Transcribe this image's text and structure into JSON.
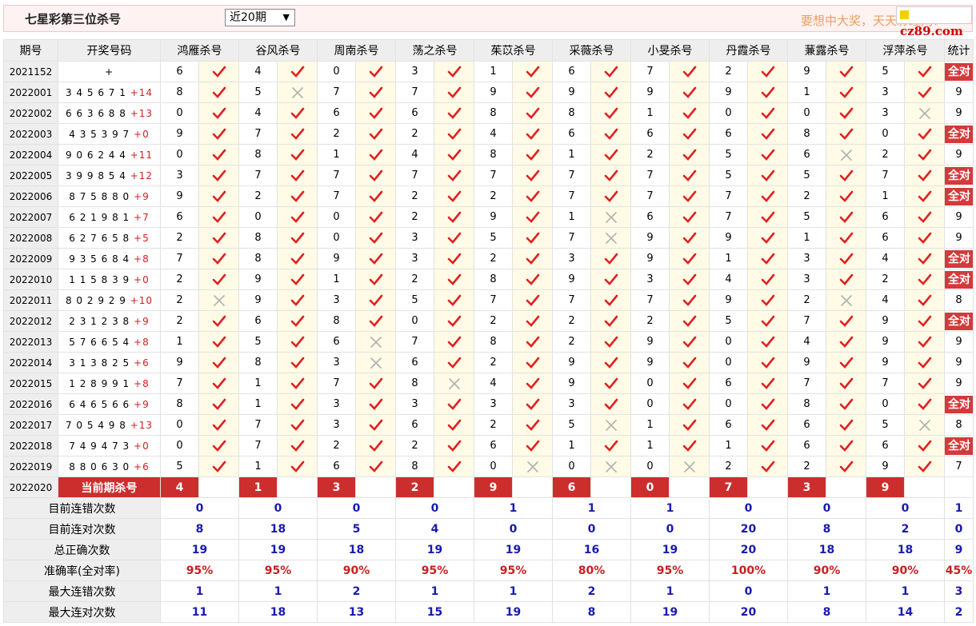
{
  "header": {
    "title": "七星彩第三位杀号",
    "period_select": "近20期",
    "slogan": "要想中大奖，天天彩经网！",
    "logo": "cz89.com"
  },
  "columns": {
    "issue": "期号",
    "draw": "开奖号码",
    "experts": [
      "鸿雁杀号",
      "谷风杀号",
      "周南杀号",
      "荡之杀号",
      "茱苡杀号",
      "采薇杀号",
      "小旻杀号",
      "丹霞杀号",
      "蒹露杀号",
      "浮萍杀号"
    ],
    "stat": "统计"
  },
  "rows": [
    {
      "issue": "2021152",
      "draw": "",
      "extra": "",
      "preds": [
        6,
        4,
        0,
        3,
        1,
        6,
        7,
        2,
        9,
        5
      ],
      "res": [
        1,
        1,
        1,
        1,
        1,
        1,
        1,
        1,
        1,
        1
      ],
      "stat": "全对"
    },
    {
      "issue": "2022001",
      "draw": "3 4 5 6 7 1",
      "extra": "14",
      "preds": [
        8,
        5,
        7,
        7,
        9,
        9,
        9,
        9,
        1,
        3
      ],
      "res": [
        1,
        0,
        1,
        1,
        1,
        1,
        1,
        1,
        1,
        1
      ],
      "stat": "9"
    },
    {
      "issue": "2022002",
      "draw": "6 6 3 6 8 8",
      "extra": "13",
      "preds": [
        0,
        4,
        6,
        6,
        8,
        8,
        1,
        0,
        0,
        3
      ],
      "res": [
        1,
        1,
        1,
        1,
        1,
        1,
        1,
        1,
        1,
        0
      ],
      "stat": "9"
    },
    {
      "issue": "2022003",
      "draw": "4 3 5 3 9 7",
      "extra": "0",
      "preds": [
        9,
        7,
        2,
        2,
        4,
        6,
        6,
        6,
        8,
        0
      ],
      "res": [
        1,
        1,
        1,
        1,
        1,
        1,
        1,
        1,
        1,
        1
      ],
      "stat": "全对"
    },
    {
      "issue": "2022004",
      "draw": "9 0 6 2 4 4",
      "extra": "11",
      "preds": [
        0,
        8,
        1,
        4,
        8,
        1,
        2,
        5,
        6,
        2
      ],
      "res": [
        1,
        1,
        1,
        1,
        1,
        1,
        1,
        1,
        0,
        1
      ],
      "stat": "9"
    },
    {
      "issue": "2022005",
      "draw": "3 9 9 8 5 4",
      "extra": "12",
      "preds": [
        3,
        7,
        7,
        7,
        7,
        7,
        7,
        5,
        5,
        7
      ],
      "res": [
        1,
        1,
        1,
        1,
        1,
        1,
        1,
        1,
        1,
        1
      ],
      "stat": "全对"
    },
    {
      "issue": "2022006",
      "draw": "8 7 5 8 8 0",
      "extra": "9",
      "preds": [
        9,
        2,
        7,
        2,
        2,
        7,
        7,
        7,
        2,
        1
      ],
      "res": [
        1,
        1,
        1,
        1,
        1,
        1,
        1,
        1,
        1,
        1
      ],
      "stat": "全对"
    },
    {
      "issue": "2022007",
      "draw": "6 2 1 9 8 1",
      "extra": "7",
      "preds": [
        6,
        0,
        0,
        2,
        9,
        1,
        6,
        7,
        5,
        6
      ],
      "res": [
        1,
        1,
        1,
        1,
        1,
        0,
        1,
        1,
        1,
        1
      ],
      "stat": "9"
    },
    {
      "issue": "2022008",
      "draw": "6 2 7 6 5 8",
      "extra": "5",
      "preds": [
        2,
        8,
        0,
        3,
        5,
        7,
        9,
        9,
        1,
        6
      ],
      "res": [
        1,
        1,
        1,
        1,
        1,
        0,
        1,
        1,
        1,
        1
      ],
      "stat": "9"
    },
    {
      "issue": "2022009",
      "draw": "9 3 5 6 8 4",
      "extra": "8",
      "preds": [
        7,
        8,
        9,
        3,
        2,
        3,
        9,
        1,
        3,
        4
      ],
      "res": [
        1,
        1,
        1,
        1,
        1,
        1,
        1,
        1,
        1,
        1
      ],
      "stat": "全对"
    },
    {
      "issue": "2022010",
      "draw": "1 1 5 8 3 9",
      "extra": "0",
      "preds": [
        2,
        9,
        1,
        2,
        8,
        9,
        3,
        4,
        3,
        2
      ],
      "res": [
        1,
        1,
        1,
        1,
        1,
        1,
        1,
        1,
        1,
        1
      ],
      "stat": "全对"
    },
    {
      "issue": "2022011",
      "draw": "8 0 2 9 2 9",
      "extra": "10",
      "preds": [
        2,
        9,
        3,
        5,
        7,
        7,
        7,
        9,
        2,
        4
      ],
      "res": [
        0,
        1,
        1,
        1,
        1,
        1,
        1,
        1,
        0,
        1
      ],
      "stat": "8"
    },
    {
      "issue": "2022012",
      "draw": "2 3 1 2 3 8",
      "extra": "9",
      "preds": [
        2,
        6,
        8,
        0,
        2,
        2,
        2,
        5,
        7,
        9
      ],
      "res": [
        1,
        1,
        1,
        1,
        1,
        1,
        1,
        1,
        1,
        1
      ],
      "stat": "全对"
    },
    {
      "issue": "2022013",
      "draw": "5 7 6 6 5 4",
      "extra": "8",
      "preds": [
        1,
        5,
        6,
        7,
        8,
        2,
        9,
        0,
        4,
        9
      ],
      "res": [
        1,
        1,
        0,
        1,
        1,
        1,
        1,
        1,
        1,
        1
      ],
      "stat": "9"
    },
    {
      "issue": "2022014",
      "draw": "3 1 3 8 2 5",
      "extra": "6",
      "preds": [
        9,
        8,
        3,
        6,
        2,
        9,
        9,
        0,
        9,
        9
      ],
      "res": [
        1,
        1,
        0,
        1,
        1,
        1,
        1,
        1,
        1,
        1
      ],
      "stat": "9"
    },
    {
      "issue": "2022015",
      "draw": "1 2 8 9 9 1",
      "extra": "8",
      "preds": [
        7,
        1,
        7,
        8,
        4,
        9,
        0,
        6,
        7,
        7
      ],
      "res": [
        1,
        1,
        1,
        0,
        1,
        1,
        1,
        1,
        1,
        1
      ],
      "stat": "9"
    },
    {
      "issue": "2022016",
      "draw": "6 4 6 5 6 6",
      "extra": "9",
      "preds": [
        8,
        1,
        3,
        3,
        3,
        3,
        0,
        0,
        8,
        0
      ],
      "res": [
        1,
        1,
        1,
        1,
        1,
        1,
        1,
        1,
        1,
        1
      ],
      "stat": "全对"
    },
    {
      "issue": "2022017",
      "draw": "7 0 5 4 9 8",
      "extra": "13",
      "preds": [
        0,
        7,
        3,
        6,
        2,
        5,
        1,
        6,
        6,
        5
      ],
      "res": [
        1,
        1,
        1,
        1,
        1,
        0,
        1,
        1,
        1,
        0
      ],
      "stat": "8"
    },
    {
      "issue": "2022018",
      "draw": "7 4 9 4 7 3",
      "extra": "0",
      "preds": [
        0,
        7,
        2,
        2,
        6,
        1,
        1,
        1,
        6,
        6
      ],
      "res": [
        1,
        1,
        1,
        1,
        1,
        1,
        1,
        1,
        1,
        1
      ],
      "stat": "全对"
    },
    {
      "issue": "2022019",
      "draw": "8 8 0 6 3 0",
      "extra": "6",
      "preds": [
        5,
        1,
        6,
        8,
        0,
        0,
        0,
        2,
        2,
        9
      ],
      "res": [
        1,
        1,
        1,
        1,
        0,
        0,
        0,
        1,
        1,
        1
      ],
      "stat": "7"
    }
  ],
  "current": {
    "issue": "2022020",
    "label": "当前期杀号",
    "preds": [
      4,
      1,
      3,
      2,
      9,
      6,
      0,
      7,
      3,
      9
    ]
  },
  "summary": [
    {
      "label": "目前连错次数",
      "values": [
        "0",
        "0",
        "0",
        "0",
        "1",
        "1",
        "1",
        "0",
        "0",
        "0",
        "1"
      ],
      "color": "blue"
    },
    {
      "label": "目前连对次数",
      "values": [
        "8",
        "18",
        "5",
        "4",
        "0",
        "0",
        "0",
        "20",
        "8",
        "2",
        "0"
      ],
      "color": "blue"
    },
    {
      "label": "总正确次数",
      "values": [
        "19",
        "19",
        "18",
        "19",
        "19",
        "16",
        "19",
        "20",
        "18",
        "18",
        "9"
      ],
      "color": "blue"
    },
    {
      "label": "准确率(全对率)",
      "values": [
        "95%",
        "95%",
        "90%",
        "95%",
        "95%",
        "80%",
        "95%",
        "100%",
        "90%",
        "90%",
        "45%"
      ],
      "color": "red"
    },
    {
      "label": "最大连错次数",
      "values": [
        "1",
        "1",
        "2",
        "1",
        "1",
        "2",
        "1",
        "0",
        "1",
        "1",
        "3"
      ],
      "color": "blue"
    },
    {
      "label": "最大连对次数",
      "values": [
        "11",
        "18",
        "13",
        "15",
        "19",
        "8",
        "19",
        "20",
        "8",
        "14",
        "2"
      ],
      "color": "blue"
    }
  ],
  "colors": {
    "check": "#e02020",
    "cross": "#b0b0b0",
    "accent": "#d33a3a"
  }
}
